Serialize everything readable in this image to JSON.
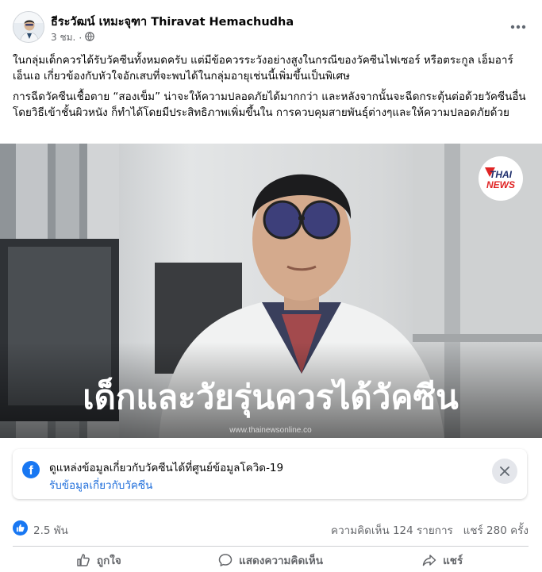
{
  "post": {
    "author": "ธีระวัฒน์ เหมะจุฑา Thiravat Hemachudha",
    "time": "3 ชม.",
    "separator": "·",
    "more_icon": "more-horizontal-icon",
    "paragraphs": [
      "ในกลุ่มเด็กควรได้รับวัคซีนทั้งหมดครับ แต่มีข้อควรระวังอย่างสูงในกรณีของวัคซีนไฟเซอร์ หรือตระกูล เอ็มอาร์เอ็นเอ เกี่ยวข้องกับหัวใจอักเสบที่จะพบได้ในกลุ่มอายุเช่นนี้เพิ่มขึ้นเป็นพิเศษ",
      "การฉีดวัคซีนเชื้อตาย “สองเข็ม” น่าจะให้ความปลอดภัยได้มากกว่า และหลังจากนั้นจะฉีดกระตุ้นต่อด้วยวัคซีนอื่นโดยวิธีเข้าชั้นผิวหนัง ก็ทำได้โดยมีประสิทธิภาพเพิ่มขึ้นใน การควบคุมสายพันธุ์ต่างๆและให้ความปลอดภัยด้วย"
    ]
  },
  "image": {
    "headline": "เด็กและวัยรุ่นควรได้วัคซีน",
    "watermark": "www.thainewsonline.co",
    "logo_line1": "THAI",
    "logo_line2": "NEWS"
  },
  "info_box": {
    "title": "ดูแหล่งข้อมูลเกี่ยวกับวัคซีนได้ที่ศูนย์ข้อมูลโควิด-19",
    "link": "รับข้อมูลเกี่ยวกับวัคซีน",
    "fb_letter": "f"
  },
  "stats": {
    "reactions": "2.5 พัน",
    "comments": "ความคิดเห็น 124 รายการ",
    "shares": "แชร์ 280 ครั้ง"
  },
  "actions": {
    "like": "ถูกใจ",
    "comment": "แสดงความคิดเห็น",
    "share": "แชร์"
  },
  "colors": {
    "accent": "#1877f2",
    "link": "#216fdb",
    "muted": "#65676b"
  }
}
